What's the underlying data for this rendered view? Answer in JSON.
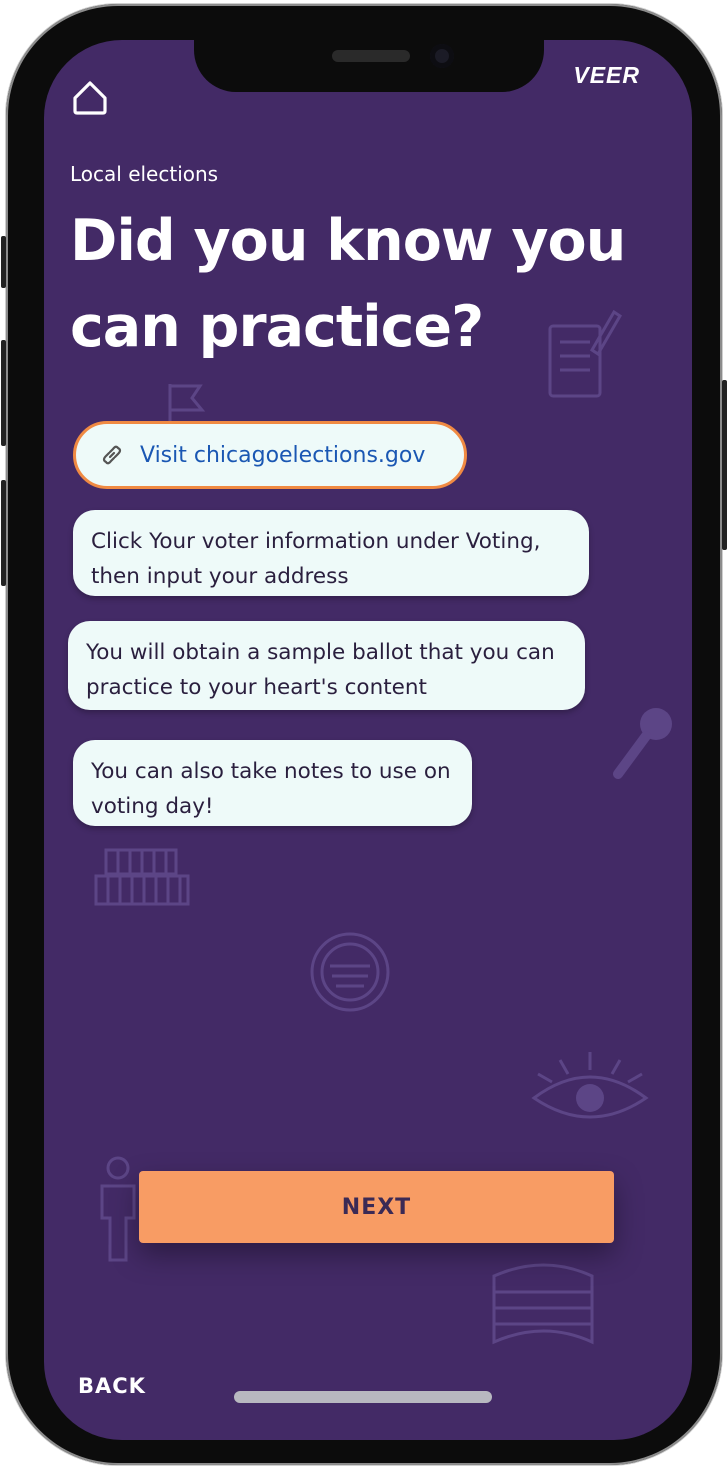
{
  "app": {
    "brand": "VEER"
  },
  "header": {
    "kicker": "Local elections",
    "title": "Did you know you can practice?"
  },
  "link": {
    "label": "Visit chicagoelections.gov",
    "icon": "link-icon"
  },
  "bubbles": [
    {
      "text": "Click Your voter information under Voting, then input your address"
    },
    {
      "text": "You will obtain a sample ballot that you can practice to your heart's content"
    },
    {
      "text": "You can also take notes to use on voting day!"
    }
  ],
  "nav": {
    "next_label": "NEXT",
    "back_label": "BACK"
  },
  "colors": {
    "background": "#432a66",
    "accent": "#f89c64",
    "bubble": "#eefaf9",
    "link": "#1a57b3",
    "link_border": "#f08a43"
  }
}
